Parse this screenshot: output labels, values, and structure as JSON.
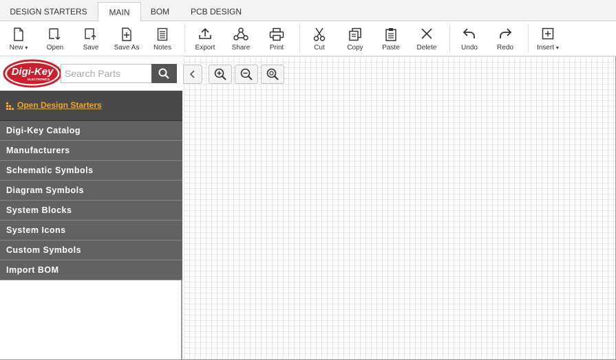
{
  "tabs": [
    {
      "label": "DESIGN STARTERS",
      "active": false
    },
    {
      "label": "MAIN",
      "active": true
    },
    {
      "label": "BOM",
      "active": false
    },
    {
      "label": "PCB DESIGN",
      "active": false
    }
  ],
  "toolbar": {
    "new": "New",
    "open": "Open",
    "save": "Save",
    "save_as": "Save As",
    "notes": "Notes",
    "export": "Export",
    "share": "Share",
    "print": "Print",
    "cut": "Cut",
    "copy": "Copy",
    "paste": "Paste",
    "delete": "Delete",
    "undo": "Undo",
    "redo": "Redo",
    "insert": "Insert",
    "dropdown_glyph": "▾"
  },
  "search": {
    "placeholder": "Search Parts",
    "value": ""
  },
  "logo": {
    "text": "Digi-Key",
    "subtext": "ELECTRONICS",
    "color": "#cc1f2e"
  },
  "sidebar": {
    "design_starters_link": "Open Design Starters",
    "items": [
      "Digi-Key Catalog",
      "Manufacturers",
      "Schematic Symbols",
      "Diagram Symbols",
      "System Blocks",
      "System Icons",
      "Custom Symbols",
      "Import BOM"
    ]
  },
  "colors": {
    "menu_bg": "#626262",
    "starter_bg": "#494949",
    "link_accent": "#f5a623",
    "search_btn": "#555555"
  }
}
